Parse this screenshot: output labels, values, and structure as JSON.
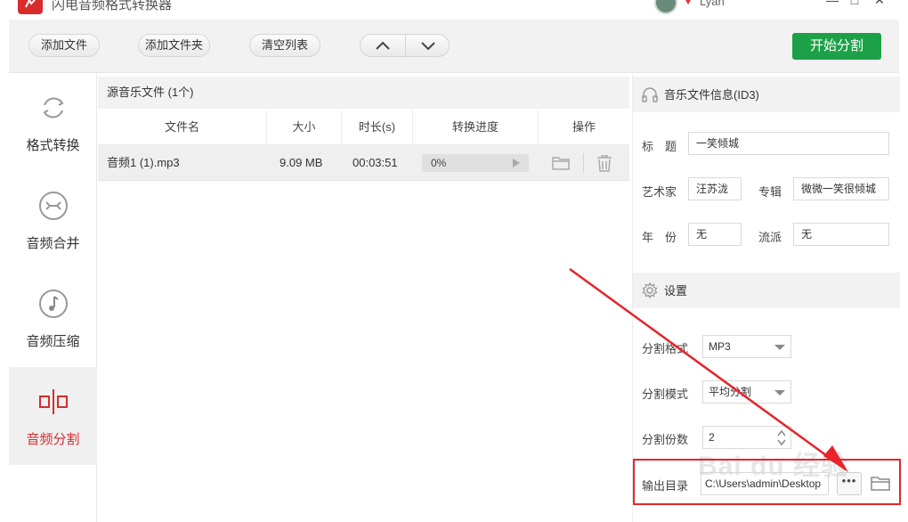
{
  "window": {
    "title": "闪电音频格式转换器",
    "user_name": "Lyan",
    "minimize_glyph": "—",
    "maximize_glyph": "□",
    "close_glyph": "✕"
  },
  "toolbar": {
    "add_file": "添加文件",
    "add_folder": "添加文件夹",
    "clear_list": "清空列表",
    "move_up_icon": "chevron-up-icon",
    "move_down_icon": "chevron-down-icon",
    "start": "开始分割"
  },
  "sidebar": {
    "items": [
      {
        "label": "格式转换",
        "icon": "refresh-icon"
      },
      {
        "label": "音频合并",
        "icon": "merge-icon"
      },
      {
        "label": "音频压缩",
        "icon": "music-note-icon"
      },
      {
        "label": "音频分割",
        "icon": "split-icon",
        "active": true
      }
    ]
  },
  "file_list": {
    "header": "源音乐文件 (1个)",
    "columns": [
      "文件名",
      "大小",
      "时长(s)",
      "转换进度",
      "操作"
    ],
    "rows": [
      {
        "name": "音频1 (1).mp3",
        "size": "9.09 MB",
        "duration": "00:03:51",
        "progress": "0%"
      }
    ]
  },
  "id3": {
    "title": "音乐文件信息(ID3)",
    "title_label": "标　题",
    "title_value": "一笑倾城",
    "artist_label": "艺术家",
    "artist_value": "汪苏泷",
    "album_label": "专辑",
    "album_value": "微微一笑很倾城",
    "year_label": "年　份",
    "year_value": "无",
    "genre_label": "流派",
    "genre_value": "无"
  },
  "settings": {
    "title": "设置",
    "format_label": "分割格式",
    "format_value": "MP3",
    "mode_label": "分割模式",
    "mode_value": "平均分割",
    "count_label": "分割份数",
    "count_value": "2",
    "output_label": "输出目录",
    "output_value": "C:\\Users\\admin\\Desktop",
    "browse_label": "•••"
  },
  "overlay": {
    "watermark": "Bai du 经验",
    "highlight_color": "#e8232b"
  },
  "colors": {
    "accent_red": "#d82c2c",
    "start_green": "#1da148"
  }
}
